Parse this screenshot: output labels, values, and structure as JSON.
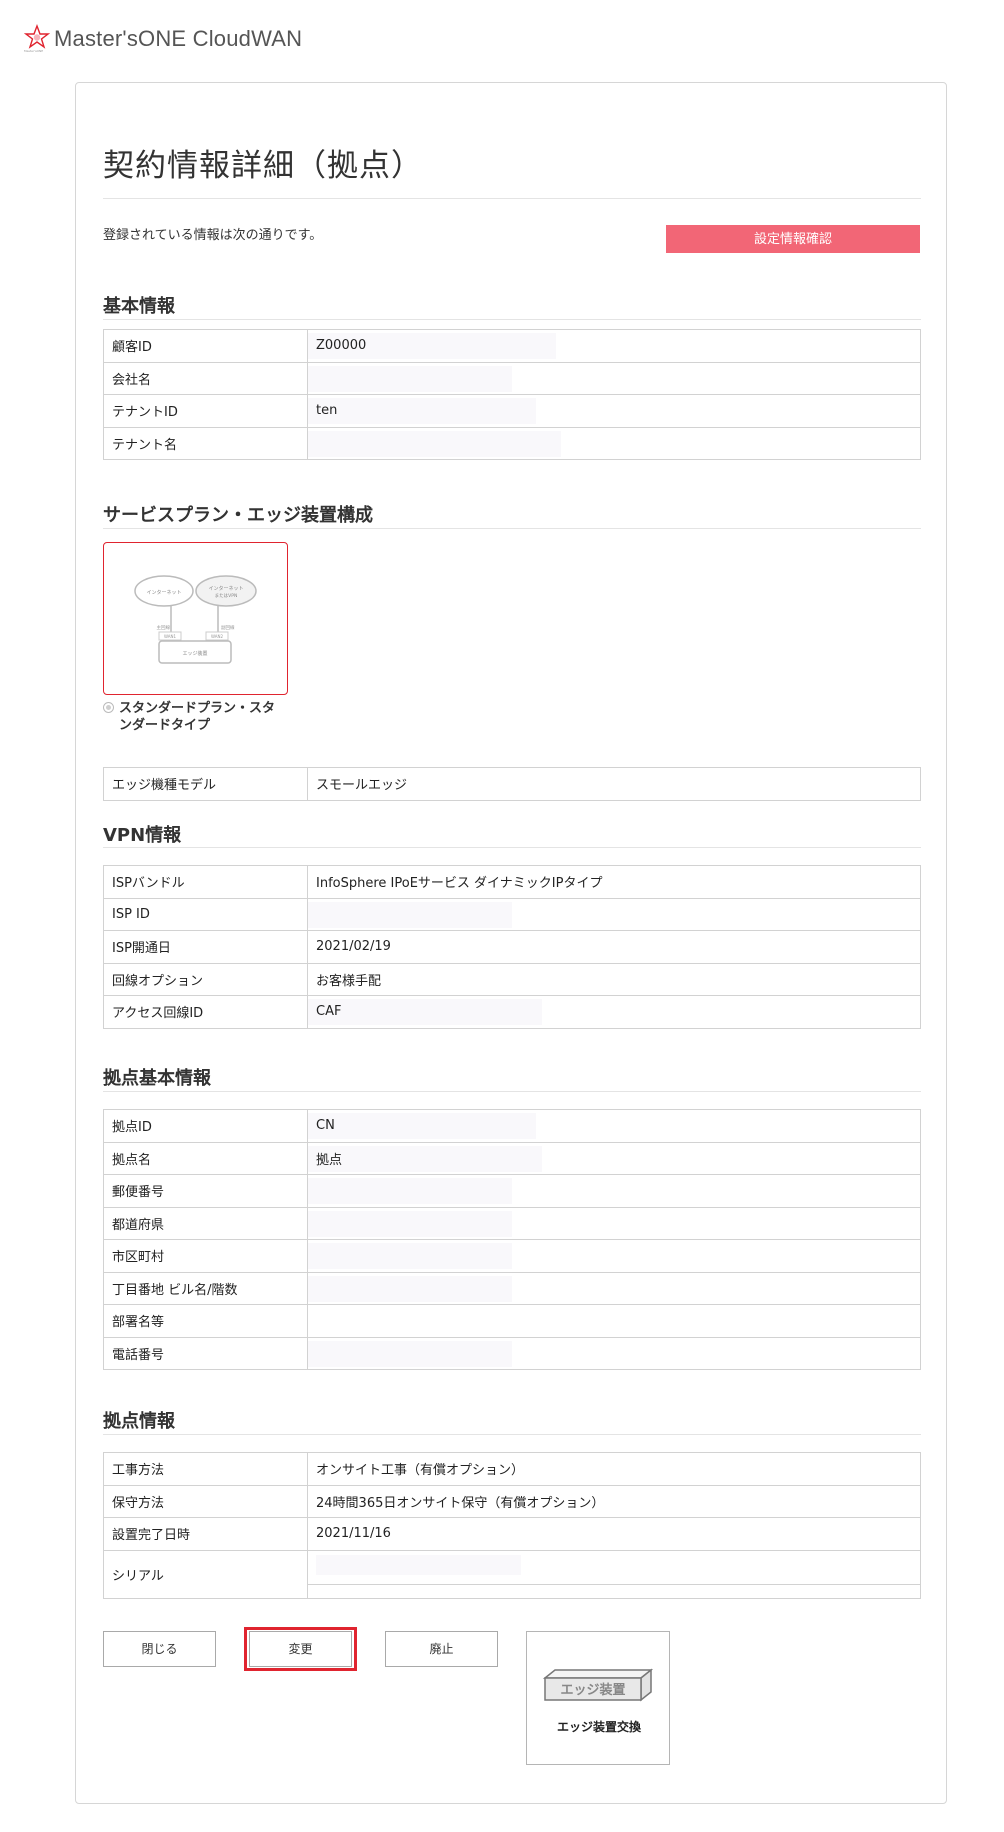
{
  "header": {
    "brand": "Master'sONE CloudWAN",
    "logo_sub": "Master'sONE",
    "logo_color": "#e0242f"
  },
  "page": {
    "title": "契約情報詳細（拠点）",
    "lead": "登録されている情報は次の通りです。",
    "confirm_button": "設定情報確認",
    "accent_color": "#f26676"
  },
  "basic": {
    "title": "基本情報",
    "rows": [
      {
        "label": "顧客ID",
        "value": "Z00000"
      },
      {
        "label": "会社名",
        "value": ""
      },
      {
        "label": "テナントID",
        "value": "ten"
      },
      {
        "label": "テナント名",
        "value": ""
      }
    ]
  },
  "plan": {
    "title": "サービスプラン・エッジ装置構成",
    "cloud_left": "インターネット",
    "cloud_right_1": "インターネット",
    "cloud_right_2": "またはVPN",
    "line_left": "主回線",
    "line_right": "副回線",
    "port_left": "WAN1",
    "port_right": "WAN2",
    "device": "エッジ装置",
    "option_label": "スタンダードプラン・スタンダードタイプ",
    "model_row": {
      "label": "エッジ機種モデル",
      "value": "スモールエッジ"
    }
  },
  "vpn": {
    "title": "VPN情報",
    "rows": [
      {
        "label": "ISPバンドル",
        "value": "InfoSphere IPoEサービス ダイナミックIPタイプ"
      },
      {
        "label": "ISP ID",
        "value": ""
      },
      {
        "label": "ISP開通日",
        "value": "2021/02/19"
      },
      {
        "label": "回線オプション",
        "value": "お客様手配"
      },
      {
        "label": "アクセス回線ID",
        "value": "CAF"
      }
    ]
  },
  "site_basic": {
    "title": "拠点基本情報",
    "rows": [
      {
        "label": "拠点ID",
        "value": "CN"
      },
      {
        "label": "拠点名",
        "value": "拠点"
      },
      {
        "label": "郵便番号",
        "value": ""
      },
      {
        "label": "都道府県",
        "value": ""
      },
      {
        "label": "市区町村",
        "value": ""
      },
      {
        "label": "丁目番地 ビル名/階数",
        "value": ""
      },
      {
        "label": "部署名等",
        "value": ""
      },
      {
        "label": "電話番号",
        "value": ""
      }
    ]
  },
  "site_info": {
    "title": "拠点情報",
    "rows": [
      {
        "label": "工事方法",
        "value": "オンサイト工事（有償オプション）"
      },
      {
        "label": "保守方法",
        "value": "24時間365日オンサイト保守（有償オプション）"
      },
      {
        "label": "設置完了日時",
        "value": "2021/11/16"
      },
      {
        "label": "シリアル",
        "value": ""
      }
    ]
  },
  "actions": {
    "close": "閉じる",
    "change": "変更",
    "abolish": "廃止",
    "edge_icon_text": "エッジ装置",
    "edge_replace": "エッジ装置交換",
    "highlight_color": "#e0242f"
  }
}
